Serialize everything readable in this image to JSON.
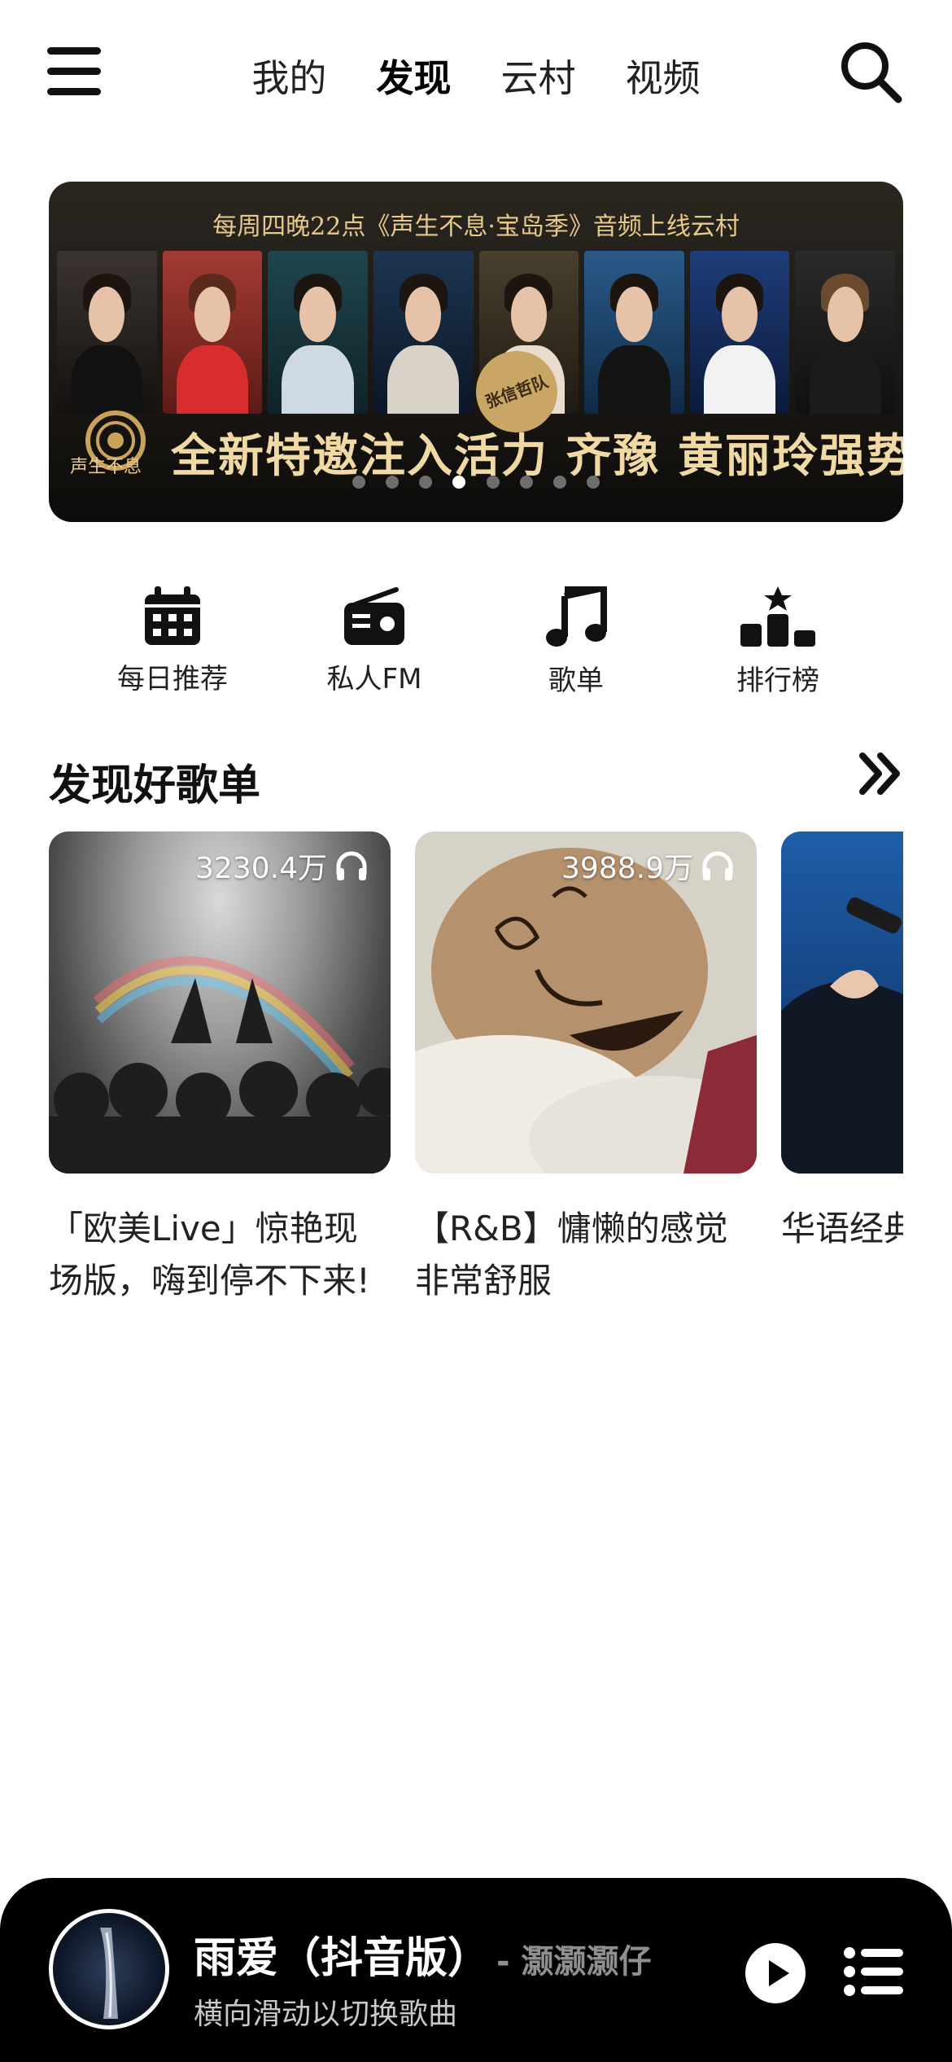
{
  "nav": {
    "menu_icon": "hamburger-menu-icon",
    "tabs": [
      {
        "label": "我的",
        "active": false
      },
      {
        "label": "发现",
        "active": true
      },
      {
        "label": "云村",
        "active": false
      },
      {
        "label": "视频",
        "active": false
      }
    ],
    "search_icon": "search-icon"
  },
  "banner": {
    "caption": "每周四晚22点《声生不息·宝岛季》音频上线云村",
    "headline": "全新特邀注入活力 齐豫 黄丽玲强势加盟",
    "logo_text": "声生不息",
    "seal_text": "张信哲队",
    "page_count": 8,
    "active_page": 4
  },
  "entries": [
    {
      "label": "每日推荐",
      "icon": "calendar-icon"
    },
    {
      "label": "私人FM",
      "icon": "radio-icon"
    },
    {
      "label": "歌单",
      "icon": "music-note-icon"
    },
    {
      "label": "排行榜",
      "icon": "podium-icon"
    }
  ],
  "section": {
    "title": "发现好歌单",
    "more_icon": "double-chevron-right-icon"
  },
  "playlists": [
    {
      "play_count": "3230.4万",
      "title": "「欧美Live」惊艳现场版，嗨到停不下来!"
    },
    {
      "play_count": "3988.9万",
      "title": "【R&B】慵懒的感觉非常舒服"
    },
    {
      "play_count": "",
      "title": "华语经典的神级L"
    }
  ],
  "player": {
    "song_title": "雨爱（抖音版）",
    "artist": "- 灏灏灏仔",
    "hint": "横向滑动以切换歌曲",
    "play_icon": "play-icon",
    "playlist_icon": "playlist-icon"
  },
  "colors": {
    "accent_text": "#111111",
    "banner_gold": "#f1d9a3",
    "player_bg": "#000000"
  }
}
